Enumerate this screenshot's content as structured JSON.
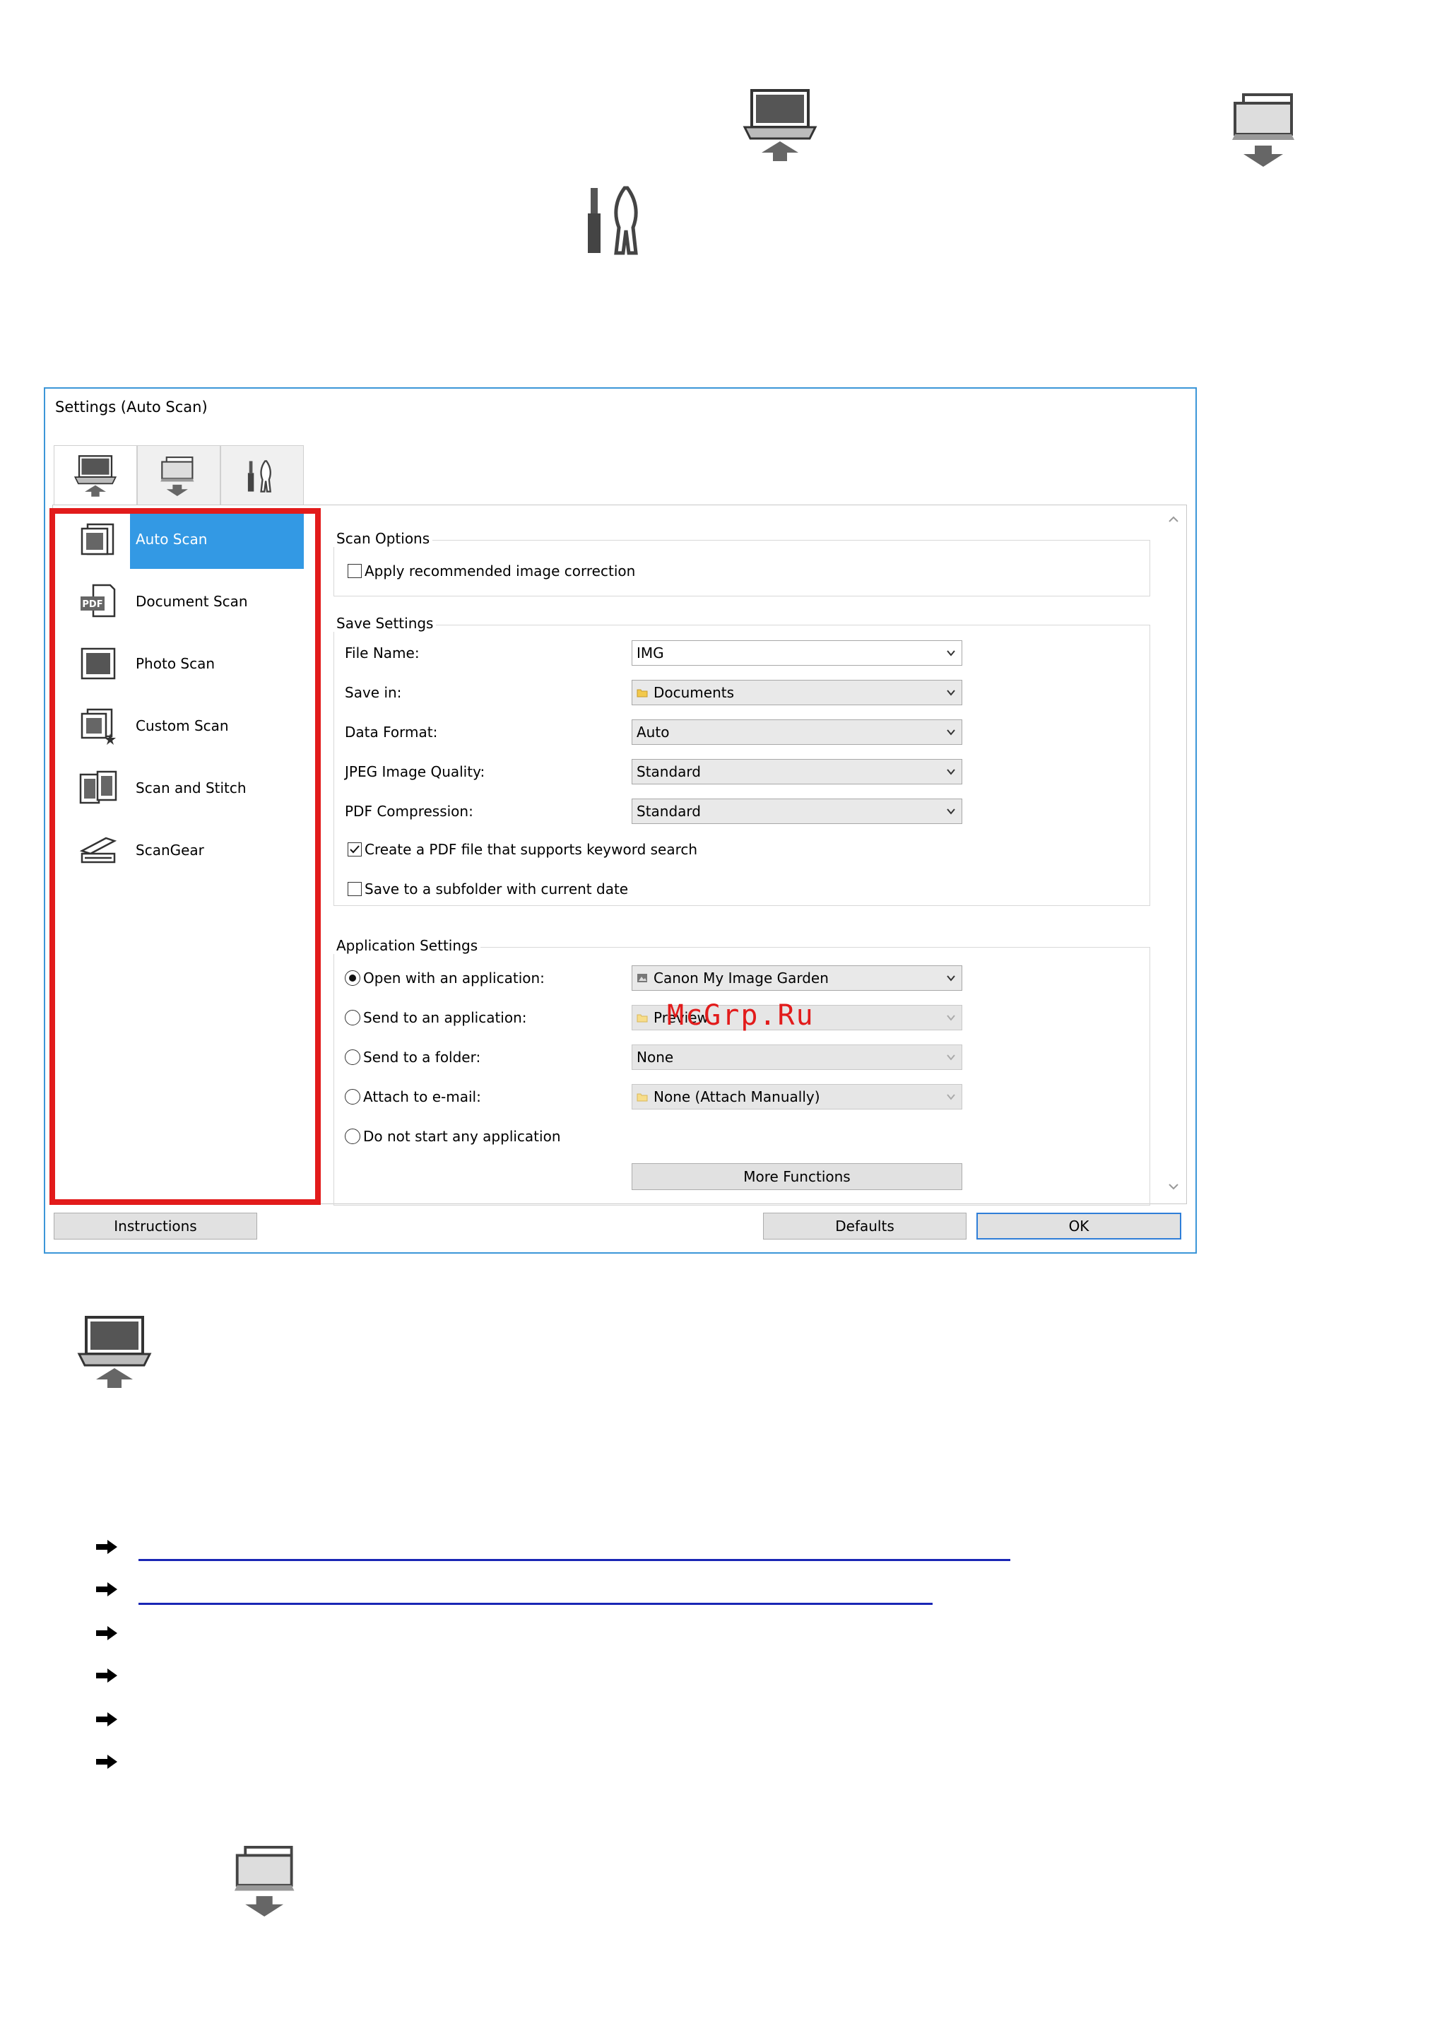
{
  "dialog": {
    "title": "Settings (Auto Scan)",
    "tabs": [
      {
        "name": "scan-from-computer-tab",
        "icon": "computer-scan-icon"
      },
      {
        "name": "scan-from-operation-panel-tab",
        "icon": "panel-scan-icon"
      },
      {
        "name": "general-settings-tab",
        "icon": "tools-icon"
      }
    ],
    "sidebar": {
      "items": [
        {
          "label": "Auto Scan",
          "icon": "auto-scan-icon",
          "selected": true
        },
        {
          "label": "Document Scan",
          "icon": "document-scan-icon"
        },
        {
          "label": "Photo Scan",
          "icon": "photo-scan-icon"
        },
        {
          "label": "Custom Scan",
          "icon": "custom-scan-icon"
        },
        {
          "label": "Scan and Stitch",
          "icon": "scan-and-stitch-icon"
        },
        {
          "label": "ScanGear",
          "icon": "scangear-icon"
        }
      ]
    },
    "scan_options": {
      "group_label": "Scan Options",
      "apply_correction": {
        "label": "Apply recommended image correction",
        "checked": false
      }
    },
    "save_settings": {
      "group_label": "Save Settings",
      "file_name": {
        "label": "File Name:",
        "value": "IMG"
      },
      "save_in": {
        "label": "Save in:",
        "value": "Documents"
      },
      "data_format": {
        "label": "Data Format:",
        "value": "Auto"
      },
      "jpeg_quality": {
        "label": "JPEG Image Quality:",
        "value": "Standard"
      },
      "pdf_compression": {
        "label": "PDF Compression:",
        "value": "Standard"
      },
      "keyword_pdf": {
        "label": "Create a PDF file that supports keyword search",
        "checked": true
      },
      "subfolder": {
        "label": "Save to a subfolder with current date",
        "checked": false
      }
    },
    "application_settings": {
      "group_label": "Application Settings",
      "open_with_app": {
        "label": "Open with an application:",
        "value": "Canon My Image Garden",
        "selected": true
      },
      "send_to_app": {
        "label": "Send to an application:",
        "value": "Preview"
      },
      "send_to_folder": {
        "label": "Send to a folder:",
        "value": "None"
      },
      "attach_email": {
        "label": "Attach to e-mail:",
        "value": "None (Attach Manually)"
      },
      "no_app": {
        "label": "Do not start any application"
      },
      "more_functions": "More Functions"
    },
    "buttons": {
      "instructions": "Instructions",
      "defaults": "Defaults",
      "ok": "OK"
    }
  },
  "watermark": "McGrp.Ru",
  "colors": {
    "accent": "#3399e4",
    "highlight_border": "#e21b1b",
    "link": "#1a26b5"
  }
}
